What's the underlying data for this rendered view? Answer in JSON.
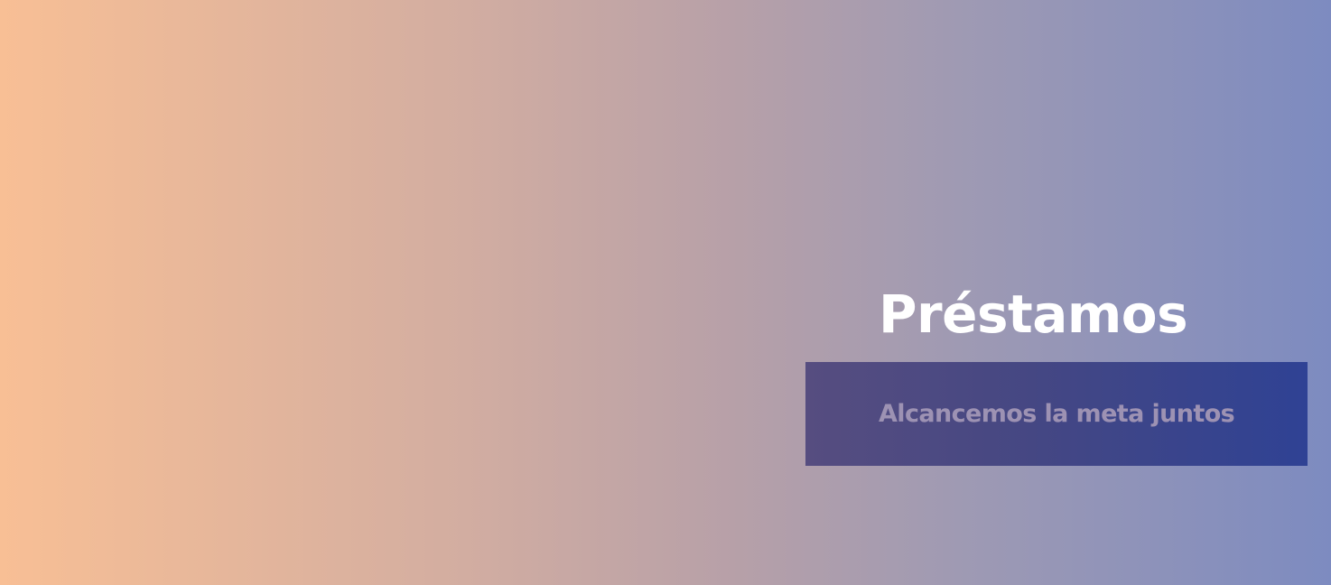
{
  "hero": {
    "title": "Préstamos",
    "subtitle": "Alcancemos la meta juntos",
    "colors": {
      "gradient_start": "#f8bf95",
      "gradient_end": "#7d8bc0",
      "banner_start": "#564d80",
      "banner_end": "#2f4294",
      "title_text": "#ffffff",
      "subtitle_text": "#9d92b3"
    }
  }
}
